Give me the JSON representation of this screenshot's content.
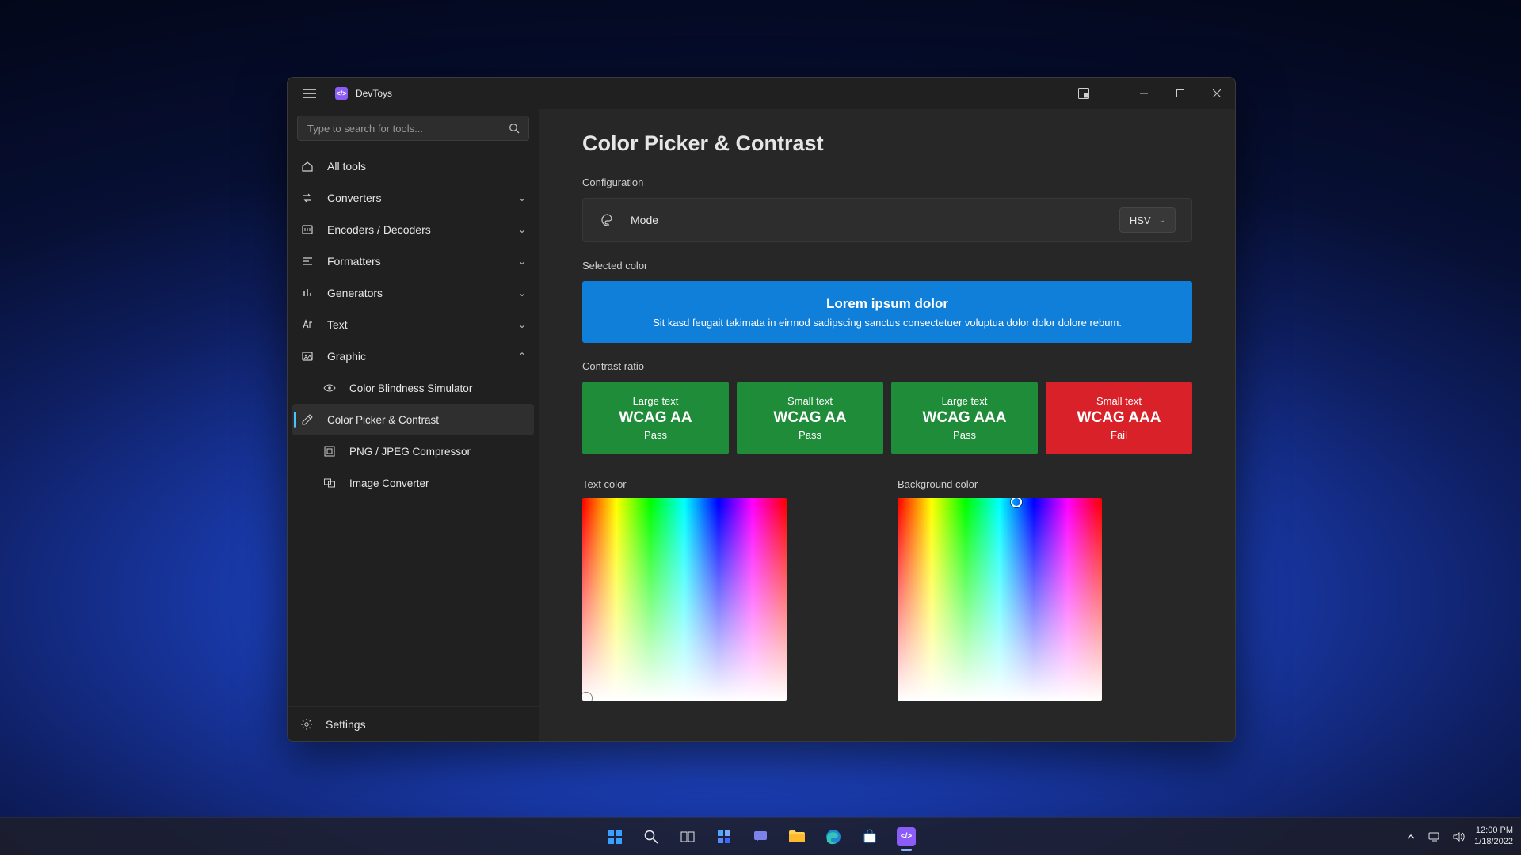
{
  "app": {
    "title": "DevToys"
  },
  "search": {
    "placeholder": "Type to search for tools..."
  },
  "sidebar": {
    "all_tools": "All tools",
    "categories": [
      {
        "label": "Converters"
      },
      {
        "label": "Encoders / Decoders"
      },
      {
        "label": "Formatters"
      },
      {
        "label": "Generators"
      },
      {
        "label": "Text"
      },
      {
        "label": "Graphic"
      }
    ],
    "graphic_children": [
      {
        "label": "Color Blindness Simulator"
      },
      {
        "label": "Color Picker & Contrast"
      },
      {
        "label": "PNG / JPEG Compressor"
      },
      {
        "label": "Image Converter"
      }
    ],
    "settings": "Settings"
  },
  "page": {
    "title": "Color Picker & Contrast",
    "config_label": "Configuration",
    "mode_label": "Mode",
    "mode_value": "HSV",
    "selected_color_label": "Selected color",
    "selected_color_hex": "#0f7fd9",
    "preview_heading": "Lorem ipsum dolor",
    "preview_sub": "Sit kasd feugait takimata in eirmod sadipscing sanctus consectetuer voluptua dolor dolor dolore rebum.",
    "contrast_ratio_label": "Contrast ratio",
    "ratios": [
      {
        "size": "Large text",
        "level": "WCAG AA",
        "status": "Pass",
        "pass": true
      },
      {
        "size": "Small text",
        "level": "WCAG AA",
        "status": "Pass",
        "pass": true
      },
      {
        "size": "Large text",
        "level": "WCAG AAA",
        "status": "Pass",
        "pass": true
      },
      {
        "size": "Small text",
        "level": "WCAG AAA",
        "status": "Fail",
        "pass": false
      }
    ],
    "text_color_label": "Text color",
    "background_color_label": "Background color"
  },
  "taskbar": {
    "time": "12:00 PM",
    "date": "1/18/2022"
  }
}
